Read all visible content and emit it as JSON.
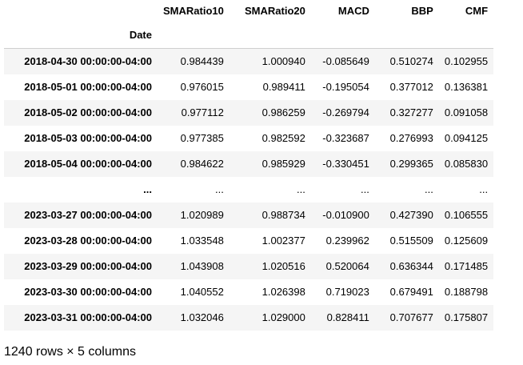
{
  "table": {
    "columns": [
      "SMARatio10",
      "SMARatio20",
      "MACD",
      "BBP",
      "CMF"
    ],
    "index_name": "Date",
    "rows": [
      {
        "index": "2018-04-30 00:00:00-04:00",
        "values": [
          "0.984439",
          "1.000940",
          "-0.085649",
          "0.510274",
          "0.102955"
        ]
      },
      {
        "index": "2018-05-01 00:00:00-04:00",
        "values": [
          "0.976015",
          "0.989411",
          "-0.195054",
          "0.377012",
          "0.136381"
        ]
      },
      {
        "index": "2018-05-02 00:00:00-04:00",
        "values": [
          "0.977112",
          "0.986259",
          "-0.269794",
          "0.327277",
          "0.091058"
        ]
      },
      {
        "index": "2018-05-03 00:00:00-04:00",
        "values": [
          "0.977385",
          "0.982592",
          "-0.323687",
          "0.276993",
          "0.094125"
        ]
      },
      {
        "index": "2018-05-04 00:00:00-04:00",
        "values": [
          "0.984622",
          "0.985929",
          "-0.330451",
          "0.299365",
          "0.085830"
        ]
      },
      {
        "index": "...",
        "values": [
          "...",
          "...",
          "...",
          "...",
          "..."
        ]
      },
      {
        "index": "2023-03-27 00:00:00-04:00",
        "values": [
          "1.020989",
          "0.988734",
          "-0.010900",
          "0.427390",
          "0.106555"
        ]
      },
      {
        "index": "2023-03-28 00:00:00-04:00",
        "values": [
          "1.033548",
          "1.002377",
          "0.239962",
          "0.515509",
          "0.125609"
        ]
      },
      {
        "index": "2023-03-29 00:00:00-04:00",
        "values": [
          "1.043908",
          "1.020516",
          "0.520064",
          "0.636344",
          "0.171485"
        ]
      },
      {
        "index": "2023-03-30 00:00:00-04:00",
        "values": [
          "1.040552",
          "1.026398",
          "0.719023",
          "0.679491",
          "0.188798"
        ]
      },
      {
        "index": "2023-03-31 00:00:00-04:00",
        "values": [
          "1.032046",
          "1.029000",
          "0.828411",
          "0.707677",
          "0.175807"
        ]
      }
    ]
  },
  "shape_text": "1240 rows × 5 columns"
}
